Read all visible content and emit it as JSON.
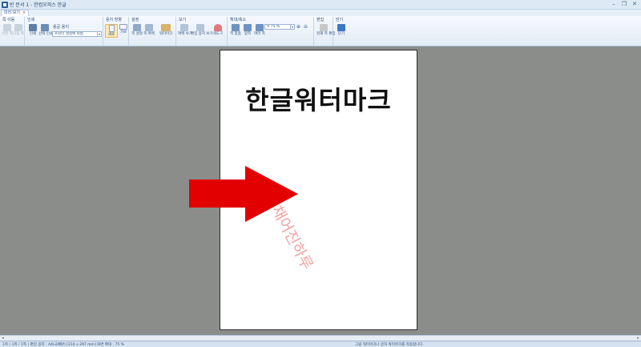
{
  "window": {
    "title": "빈 문서 1 - 한컴오피스 한글"
  },
  "tab": {
    "label": "미리 보기",
    "close": "×"
  },
  "ribbon": {
    "groups": {
      "move": {
        "title": "쪽 이동",
        "prev": "이전 쪽",
        "next": "다음 쪽"
      },
      "print": {
        "title": "인쇄",
        "print": "인쇄",
        "select_print": "선택 인쇄",
        "paper_label": "용공 용지",
        "printer_value": "프린터 설정에 따름"
      },
      "orientation": {
        "title": "용지 방향",
        "portrait": "세로",
        "landscape": "가로"
      },
      "settings": {
        "title": "설정",
        "fit": "쪽 설정",
        "margins": "쪽 여백",
        "watermark": "워터마크"
      },
      "view": {
        "title": "보기",
        "margin_view": "여백 보기",
        "edit_view": "편집 용지 보기",
        "color": "색도구"
      },
      "zoom": {
        "title": "확대/축소",
        "fit_width": "쪽 맞춤",
        "two_pages": "맞쪽",
        "multi_pages": "여러 쪽",
        "zoom_value": "75 %"
      },
      "edit": {
        "title": "편집",
        "edit_current": "현재 쪽 편집"
      },
      "close": {
        "title": "닫기",
        "close": "닫기"
      }
    }
  },
  "document": {
    "heading": "한글워터마크",
    "watermark_text": "채어진하루"
  },
  "colors": {
    "arrow": "#e30000",
    "workspace": "#8a8d89",
    "watermark": "#f2a3a3"
  },
  "statusbar": {
    "left": "1쪽 ( 1쪽 / 1쪽 )  편집 용지 : A4(국배판)  [210 x 297 mm]  화면 확대 : 75 %",
    "right": "그림 워터마크나 글자 워터마크를 적용합니다."
  }
}
